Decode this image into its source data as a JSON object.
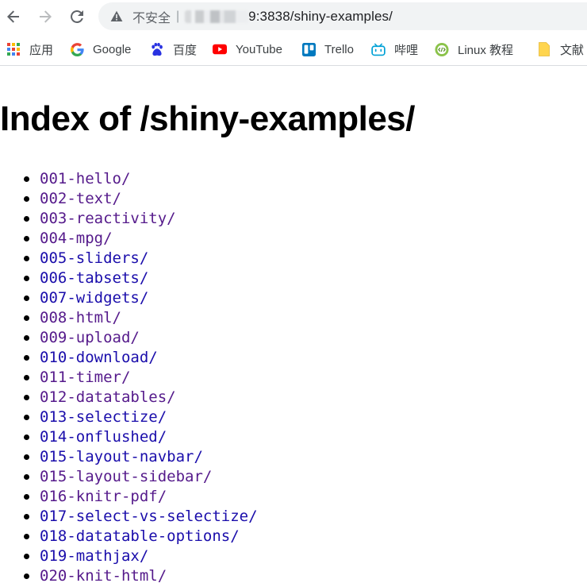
{
  "address_bar": {
    "security_label": "不安全",
    "separator": "|",
    "url_visible": "9:3838/shiny-examples/"
  },
  "bookmarks": [
    {
      "label": "应用",
      "icon": "apps-grid-icon"
    },
    {
      "label": "Google",
      "icon": "google-icon"
    },
    {
      "label": "百度",
      "icon": "baidu-paw-icon"
    },
    {
      "label": "YouTube",
      "icon": "youtube-icon"
    },
    {
      "label": "Trello",
      "icon": "trello-icon"
    },
    {
      "label": "哔哩",
      "icon": "bilibili-icon"
    },
    {
      "label": "Linux 教程",
      "icon": "linux-tutorial-icon"
    },
    {
      "label": "文献",
      "icon": "folder-icon"
    }
  ],
  "page": {
    "title": "Index of /shiny-examples/",
    "entries": [
      {
        "label": "001-hello/",
        "visited": true
      },
      {
        "label": "002-text/",
        "visited": true
      },
      {
        "label": "003-reactivity/",
        "visited": true
      },
      {
        "label": "004-mpg/",
        "visited": true
      },
      {
        "label": "005-sliders/",
        "visited": false
      },
      {
        "label": "006-tabsets/",
        "visited": false
      },
      {
        "label": "007-widgets/",
        "visited": false
      },
      {
        "label": "008-html/",
        "visited": true
      },
      {
        "label": "009-upload/",
        "visited": true
      },
      {
        "label": "010-download/",
        "visited": false
      },
      {
        "label": "011-timer/",
        "visited": true
      },
      {
        "label": "012-datatables/",
        "visited": true
      },
      {
        "label": "013-selectize/",
        "visited": false
      },
      {
        "label": "014-onflushed/",
        "visited": false
      },
      {
        "label": "015-layout-navbar/",
        "visited": false
      },
      {
        "label": "015-layout-sidebar/",
        "visited": true
      },
      {
        "label": "016-knitr-pdf/",
        "visited": true
      },
      {
        "label": "017-select-vs-selectize/",
        "visited": false
      },
      {
        "label": "018-datatable-options/",
        "visited": false
      },
      {
        "label": "019-mathjax/",
        "visited": false
      },
      {
        "label": "020-knit-html/",
        "visited": true
      }
    ]
  },
  "colors": {
    "link": "#1a0dab",
    "visited_link": "#551a8b",
    "youtube_red": "#ff0000",
    "trello_blue": "#0079bf",
    "bilibili_blue": "#00a1d6"
  }
}
